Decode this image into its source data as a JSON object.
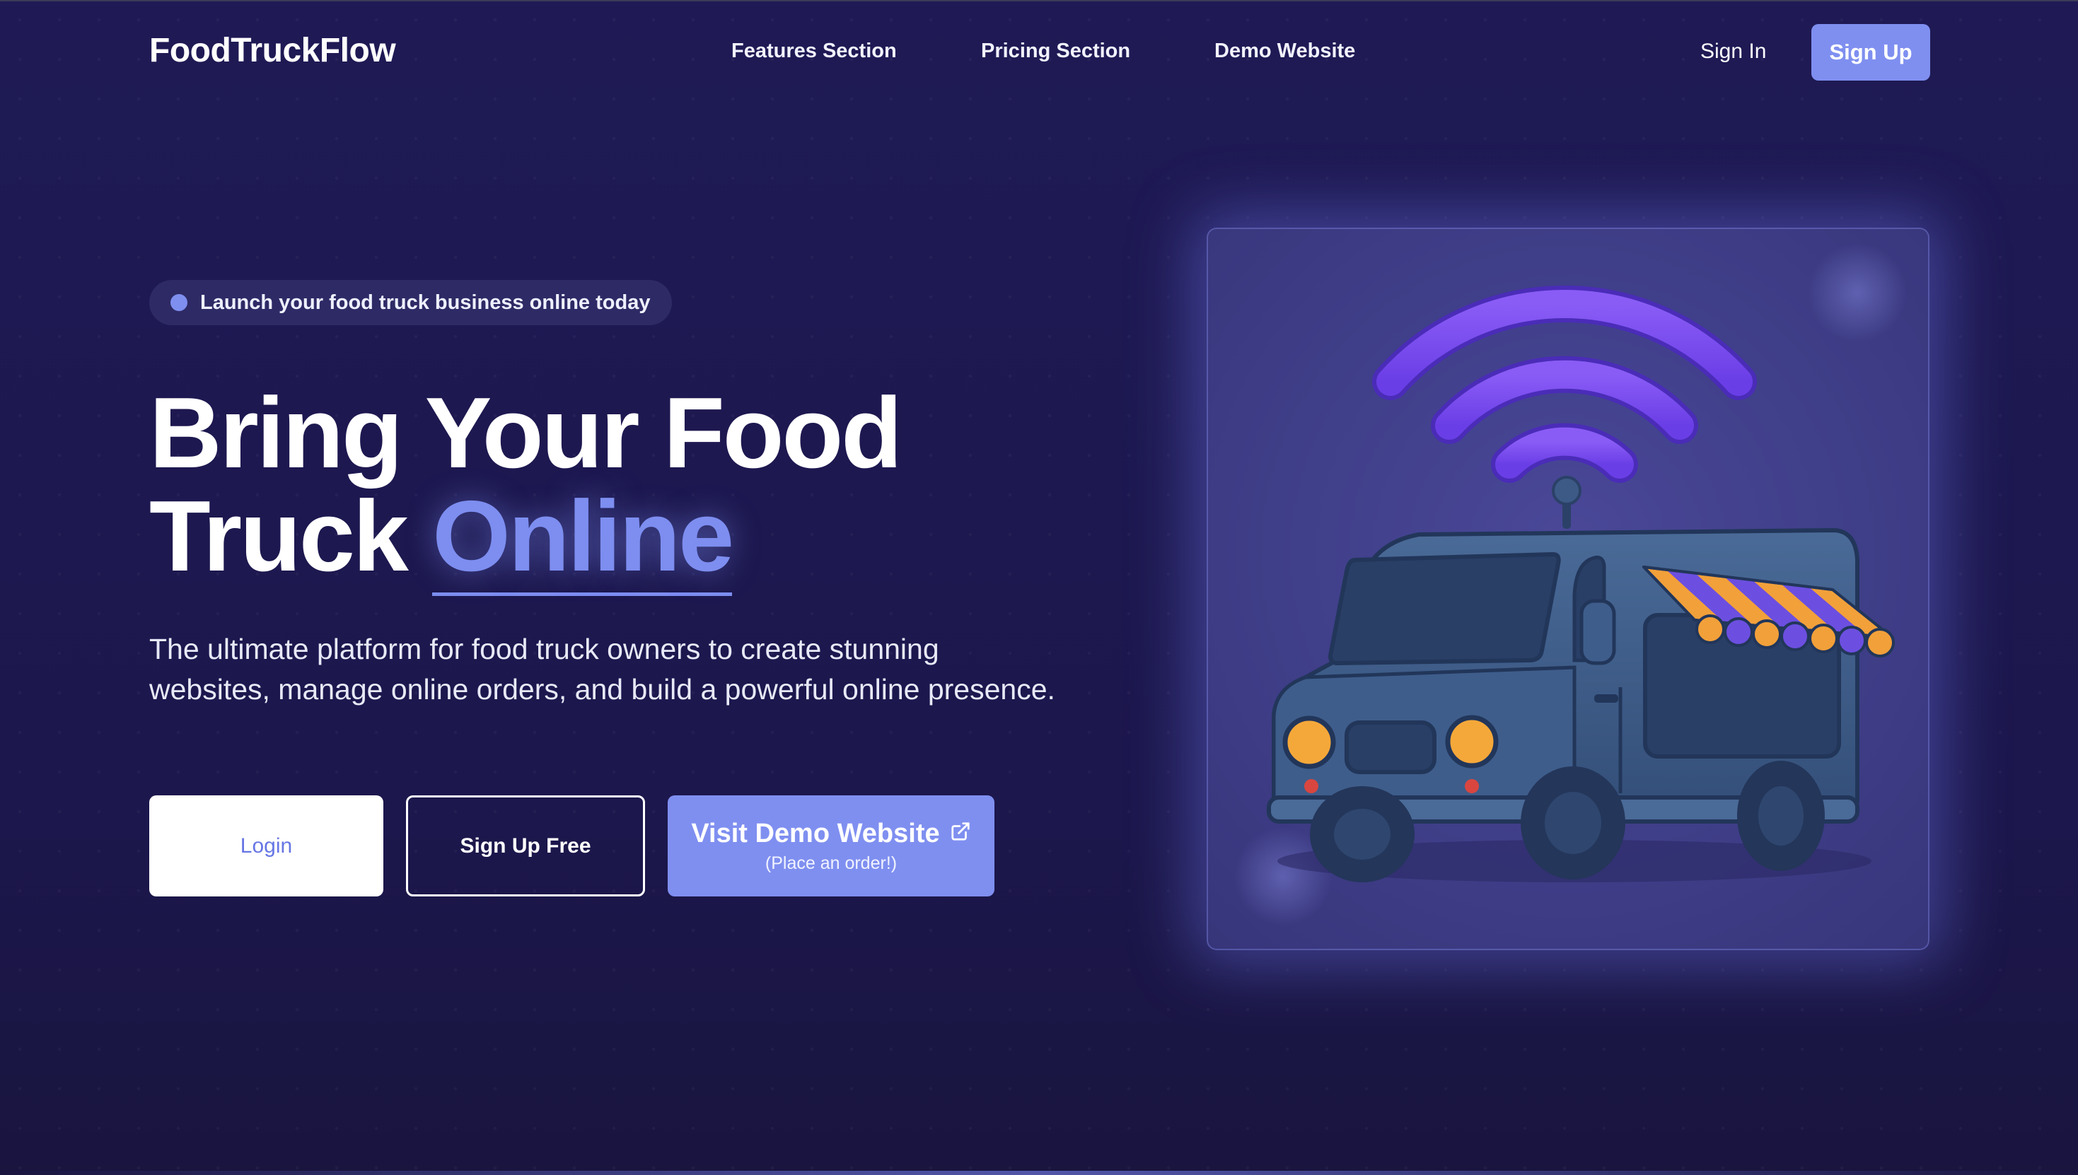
{
  "nav": {
    "brand": "FoodTruckFlow",
    "links": [
      {
        "label": "Features Section"
      },
      {
        "label": "Pricing Section"
      },
      {
        "label": "Demo Website"
      }
    ],
    "sign_in": "Sign In",
    "sign_up": "Sign Up"
  },
  "hero": {
    "badge": "Launch your food truck business online today",
    "title_line1": "Bring Your Food",
    "title_line2_plain": "Truck",
    "title_line2_accent": "Online",
    "description": "The ultimate platform for food truck owners to create stunning websites, manage online orders, and build a powerful online presence."
  },
  "buttons": {
    "login": "Login",
    "signup_free": "Sign Up Free",
    "demo_label": "Visit Demo Website",
    "demo_sub": "(Place an order!)"
  },
  "illustration": {
    "icons": [
      "food-truck-icon",
      "wifi-signal-icon",
      "external-link-icon"
    ]
  },
  "colors": {
    "background": "#1d1850",
    "accent": "#7f8ff0",
    "accent_text": "#7d8ef0",
    "illustration_panel": "#403e8a",
    "truck_body": "#3d5a86",
    "wifi": "#7a4df0",
    "awning_orange": "#f2a03a",
    "awning_purple": "#6c4fe0"
  }
}
